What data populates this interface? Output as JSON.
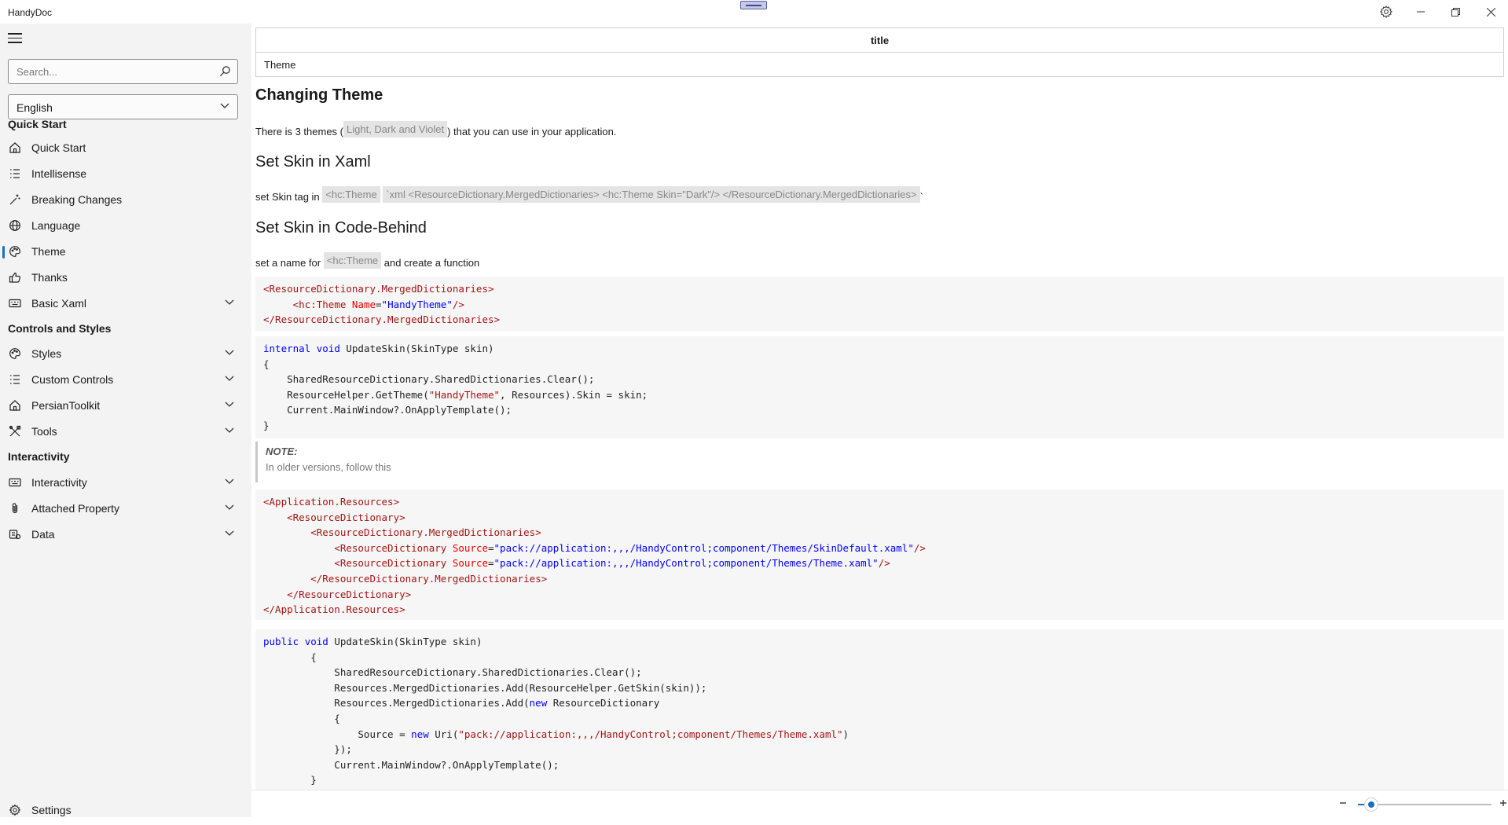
{
  "window": {
    "title": "HandyDoc"
  },
  "sidebar": {
    "search_placeholder": "Search...",
    "language": "English",
    "sections": [
      "Quick Start",
      "Controls and Styles",
      "Interactivity"
    ],
    "items": [
      {
        "label": "Quick Start",
        "icon": "home-icon"
      },
      {
        "label": "Intellisense",
        "icon": "list-icon"
      },
      {
        "label": "Breaking Changes",
        "icon": "wand-icon"
      },
      {
        "label": "Language",
        "icon": "globe-icon"
      },
      {
        "label": "Theme",
        "icon": "palette-icon",
        "selected": true
      },
      {
        "label": "Thanks",
        "icon": "thumbs-up-icon"
      },
      {
        "label": "Basic Xaml",
        "icon": "keyboard-icon",
        "expandable": true
      },
      {
        "label": "Styles",
        "icon": "palette-icon",
        "expandable": true
      },
      {
        "label": "Custom Controls",
        "icon": "list-icon",
        "expandable": true
      },
      {
        "label": "PersianToolkit",
        "icon": "home-icon",
        "expandable": true
      },
      {
        "label": "Tools",
        "icon": "tools-icon",
        "expandable": true
      },
      {
        "label": "Interactivity",
        "icon": "keyboard-icon",
        "expandable": true
      },
      {
        "label": "Attached Property",
        "icon": "paperclip-icon",
        "expandable": true
      },
      {
        "label": "Data",
        "icon": "data-icon",
        "expandable": true
      }
    ],
    "settings_label": "Settings"
  },
  "doc": {
    "meta_header": "title",
    "meta_value": "Theme",
    "heading": "Changing Theme",
    "p1_before": "There is 3 themes (",
    "p1_chip": "Light, Dark and Violet",
    "p1_after": ") that you can use in your application.",
    "h_xaml": "Set Skin in Xaml",
    "p2_before": "set Skin tag in",
    "p2_chip1": "<hc:Theme",
    "p2_chip2": "`xml <ResourceDictionary.MergedDictionaries> <hc:Theme Skin=\"Dark\"/> </ResourceDictionary.MergedDictionaries>",
    "p2_after": "`",
    "h_code": "Set Skin in Code-Behind",
    "p3_before": "set a name for",
    "p3_chip": "<hc:Theme",
    "p3_after": "and create a function",
    "note_title": "NOTE:",
    "note_body": "In older versions, follow this"
  },
  "statusbar": {
    "zoom_fraction": 0.1
  },
  "colors": {
    "accent": "#1d6fbd",
    "sidebar_bg": "#f3f3f3",
    "code_bg": "#f6f6f6"
  }
}
